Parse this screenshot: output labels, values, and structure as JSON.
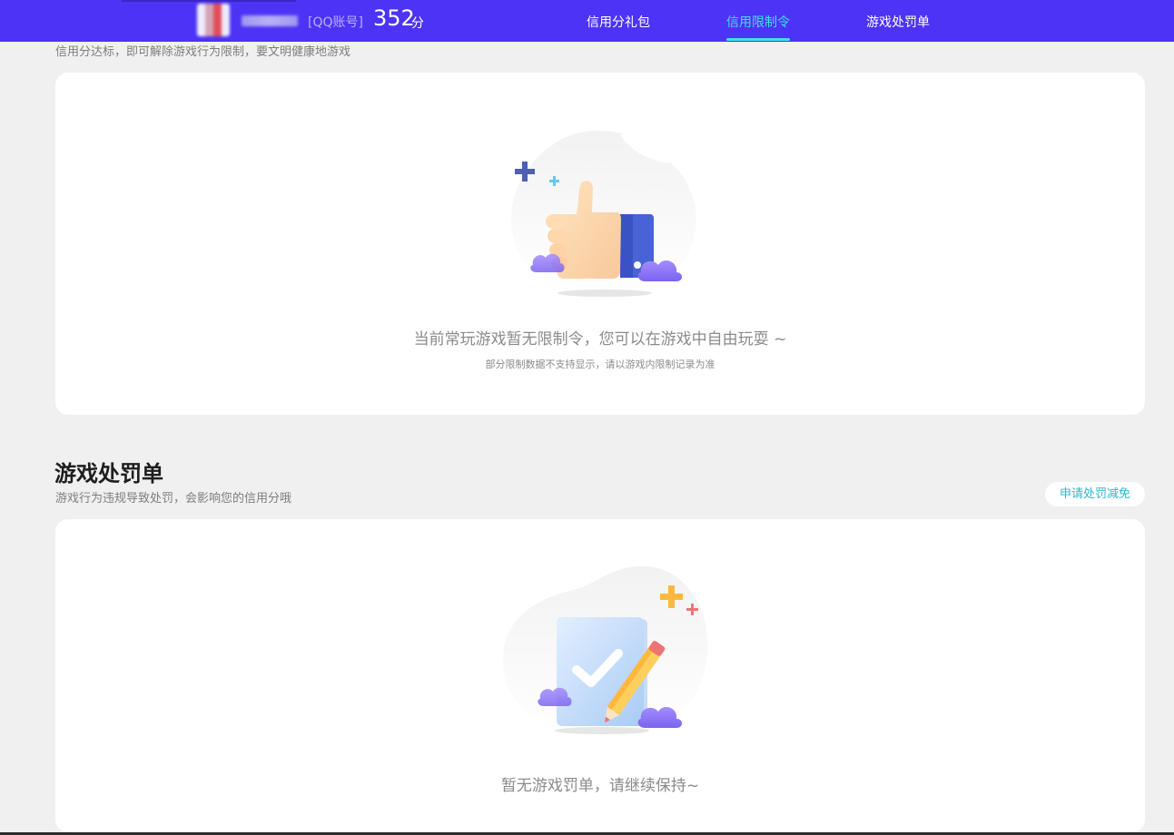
{
  "header": {
    "account_type": "[QQ账号]",
    "score": "352",
    "score_unit": "分",
    "tabs": [
      {
        "label": "信用分礼包",
        "active": false
      },
      {
        "label": "信用限制令",
        "active": true
      },
      {
        "label": "游戏处罚单",
        "active": false
      }
    ]
  },
  "restriction": {
    "description": "信用分达标，即可解除游戏行为限制，要文明健康地游戏",
    "empty_message": "当前常玩游戏暂无限制令，您可以在游戏中自由玩耍 ~",
    "empty_note": "部分限制数据不支持显示，请以游戏内限制记录为准"
  },
  "penalty": {
    "title": "游戏处罚单",
    "description": "游戏行为违规导致处罚，会影响您的信用分哦",
    "apply_button": "申请处罚减免",
    "empty_message": "暂无游戏罚单，请继续保持~"
  },
  "colors": {
    "header_bg": "#4d33f5",
    "active_tab": "#3ee0ea",
    "apply_text": "#2fb7c9"
  },
  "icons": [
    "thumbs-up-illustration",
    "clipboard-check-illustration",
    "pencil-icon",
    "cloud-icon",
    "sparkle-icon"
  ]
}
